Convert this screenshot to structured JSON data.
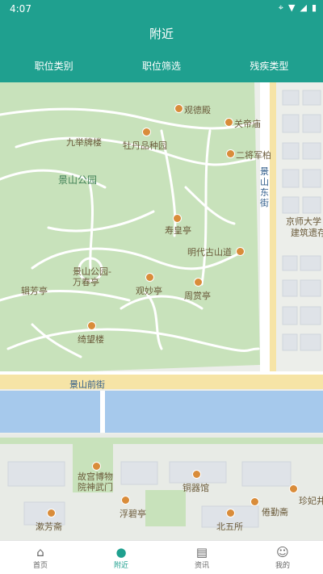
{
  "status": {
    "time": "4:07"
  },
  "header": {
    "title": "附近"
  },
  "filters": [
    {
      "label": "职位类别"
    },
    {
      "label": "职位筛选"
    },
    {
      "label": "残疾类型"
    }
  ],
  "map": {
    "labels": {
      "jingshan_park": "景山公园",
      "guandedian": "观德殿",
      "guandimiao": "关帝庙",
      "jiujuchanglou": "九举牌楼",
      "mudan_garden": "牡丹品种园",
      "erjiangjun": "二将军柏",
      "shouhuangting": "寿皇亭",
      "mingdai_road": "明代古山道",
      "jingshan_east": "景山东街",
      "jingshi_univ": "京师大学",
      "jianzhu": "建筑遗存",
      "wanchunting": "景山公园-万春亭",
      "jifangting": "辑芳亭",
      "guanmiaoting": "观妙亭",
      "zhoushangting": "周赏亭",
      "qiwanglou": "绮望楼",
      "jingshan_front": "景山前街",
      "gugong": "故宫博物院神武门",
      "tongqiguan": "铜器馆",
      "fubiting": "浮碧亭",
      "jianfangzhai": "漱芳斋",
      "beiwusuo": "北五所",
      "juanqinzhai": "倦勤斋",
      "zhenfei": "珍妃井"
    }
  },
  "nav": [
    {
      "label": "首页",
      "icon": "home-icon"
    },
    {
      "label": "附近",
      "icon": "location-pin-icon"
    },
    {
      "label": "资讯",
      "icon": "news-icon"
    },
    {
      "label": "我的",
      "icon": "user-icon"
    }
  ],
  "colors": {
    "brand": "#1fa08f",
    "park": "#c8e2bb",
    "moat": "#a6c9ec",
    "road": "#f6e4a6"
  }
}
